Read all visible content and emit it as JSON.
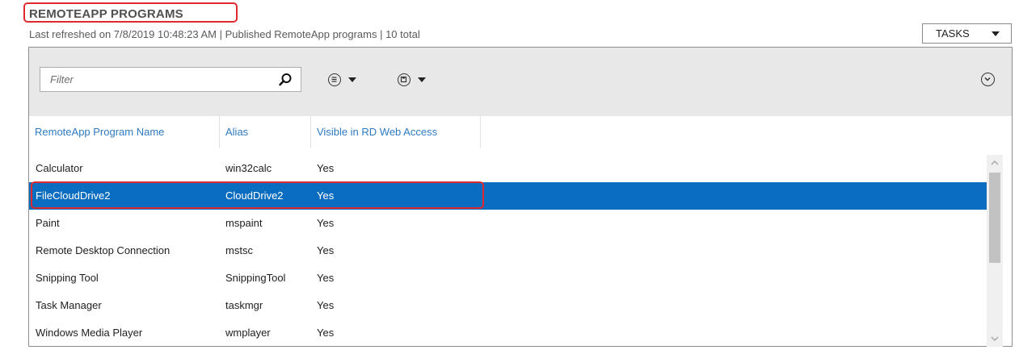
{
  "header": {
    "title": "REMOTEAPP PROGRAMS",
    "subtitle": "Last refreshed on 7/8/2019 10:48:23 AM | Published RemoteApp programs | 10 total",
    "tasks_label": "TASKS"
  },
  "toolbar": {
    "filter_placeholder": "Filter",
    "filter_value": "",
    "icons": [
      "search-icon",
      "list-options-icon",
      "save-icon",
      "expand-icon"
    ]
  },
  "table": {
    "columns": [
      "RemoteApp Program Name",
      "Alias",
      "Visible in RD Web Access"
    ],
    "rows": [
      {
        "name": "Calculator",
        "alias": "win32calc",
        "visible": "Yes"
      },
      {
        "name": "FileCloudDrive2",
        "alias": "CloudDrive2",
        "visible": "Yes"
      },
      {
        "name": "Paint",
        "alias": "mspaint",
        "visible": "Yes"
      },
      {
        "name": "Remote Desktop Connection",
        "alias": "mstsc",
        "visible": "Yes"
      },
      {
        "name": "Snipping Tool",
        "alias": "SnippingTool",
        "visible": "Yes"
      },
      {
        "name": "Task Manager",
        "alias": "taskmgr",
        "visible": "Yes"
      },
      {
        "name": "Windows Media Player",
        "alias": "wmplayer",
        "visible": "Yes"
      }
    ],
    "selected_row": "FileCloudDrive2"
  },
  "colors": {
    "accent": "#2e7ac2",
    "selection": "#0a6dbf",
    "highlight": "#e0282f"
  }
}
